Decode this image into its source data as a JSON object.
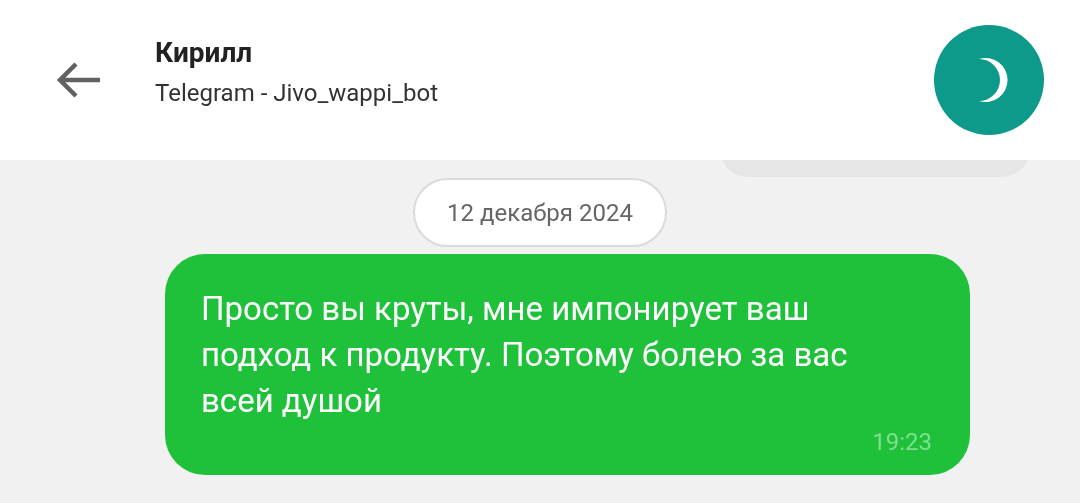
{
  "header": {
    "title": "Кирилл",
    "subtitle": "Telegram - Jivo_wappi_bot"
  },
  "date_separator": "12 декабря 2024",
  "messages": [
    {
      "text": "Просто вы круты, мне импонирует ваш подход к продукту. Поэтому болею за вас всей душой",
      "time": "19:23",
      "outgoing": true
    }
  ]
}
